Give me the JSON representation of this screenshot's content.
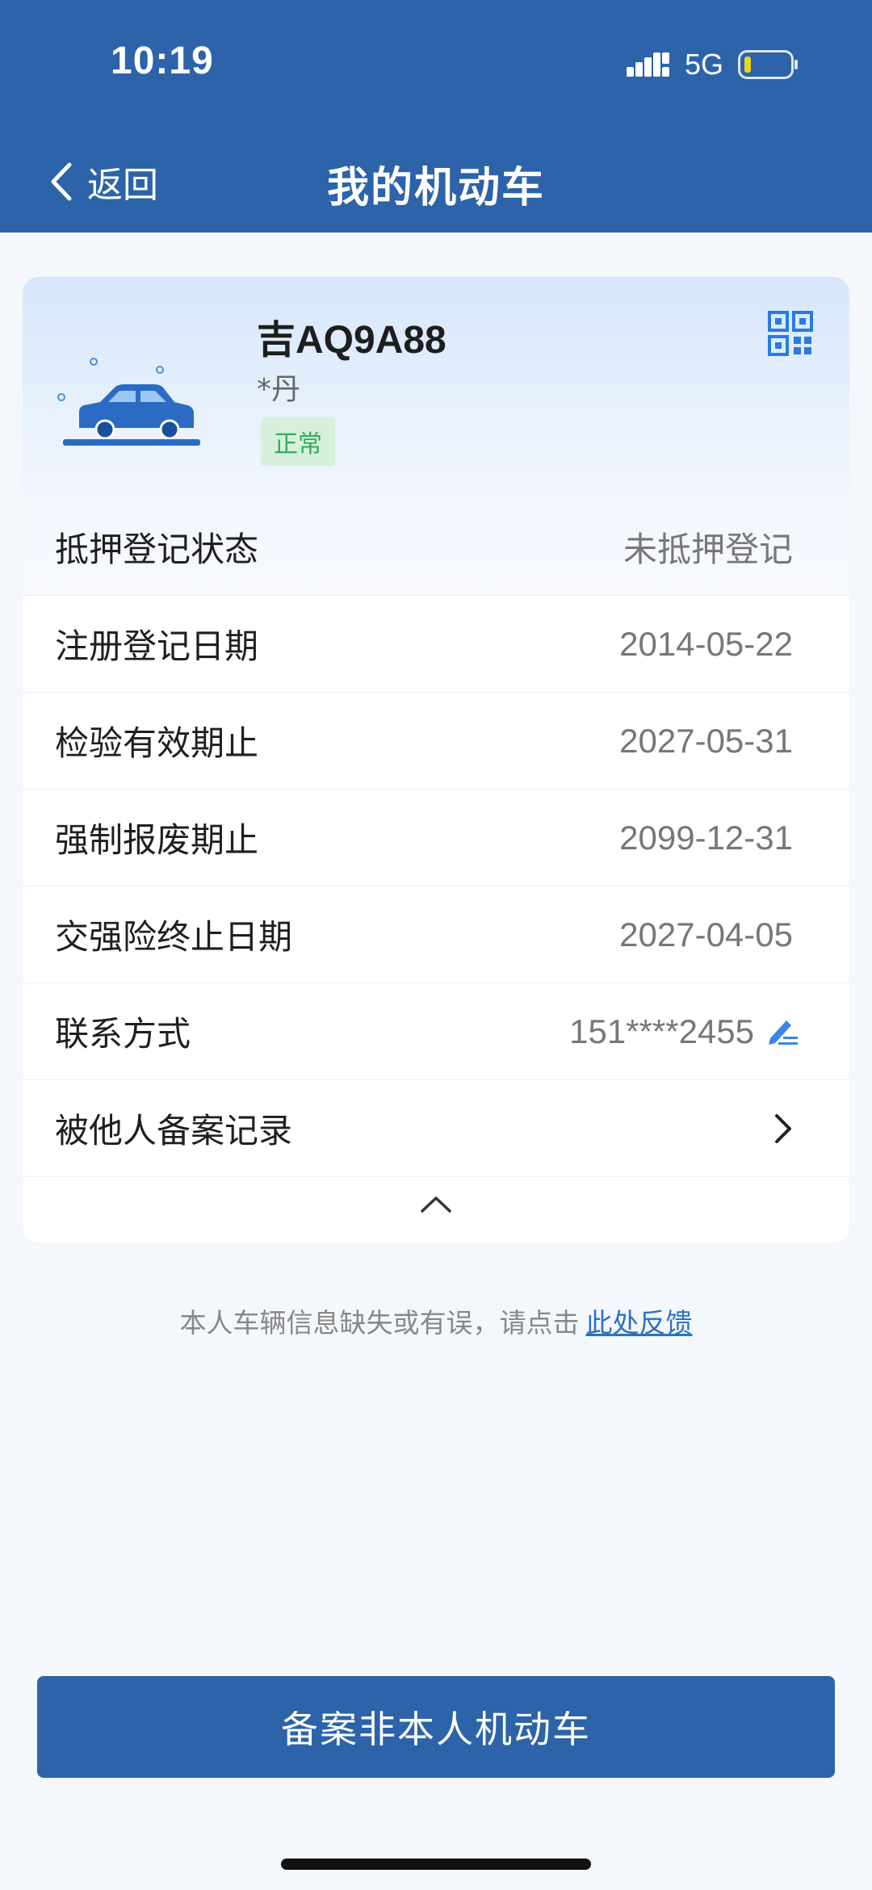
{
  "status_bar": {
    "time": "10:19",
    "network": "5G"
  },
  "nav": {
    "back_label": "返回",
    "title": "我的机动车"
  },
  "vehicle": {
    "plate": "吉AQ9A88",
    "owner": "*丹",
    "status": "正常",
    "status_color": "#2fae59"
  },
  "info_rows": [
    {
      "label": "抵押登记状态",
      "value": "未抵押登记"
    },
    {
      "label": "注册登记日期",
      "value": "2014-05-22"
    },
    {
      "label": "检验有效期止",
      "value": "2027-05-31"
    },
    {
      "label": "强制报废期止",
      "value": "2099-12-31"
    },
    {
      "label": "交强险终止日期",
      "value": "2027-04-05"
    },
    {
      "label": "联系方式",
      "value": "151****2455"
    },
    {
      "label": "被他人备案记录",
      "value": ""
    }
  ],
  "feedback": {
    "text": "本人车辆信息缺失或有误，请点击",
    "link": "此处反馈"
  },
  "primary_button": {
    "label": "备案非本人机动车"
  },
  "colors": {
    "brand": "#2c63a9",
    "accent_link": "#2a72c2"
  }
}
